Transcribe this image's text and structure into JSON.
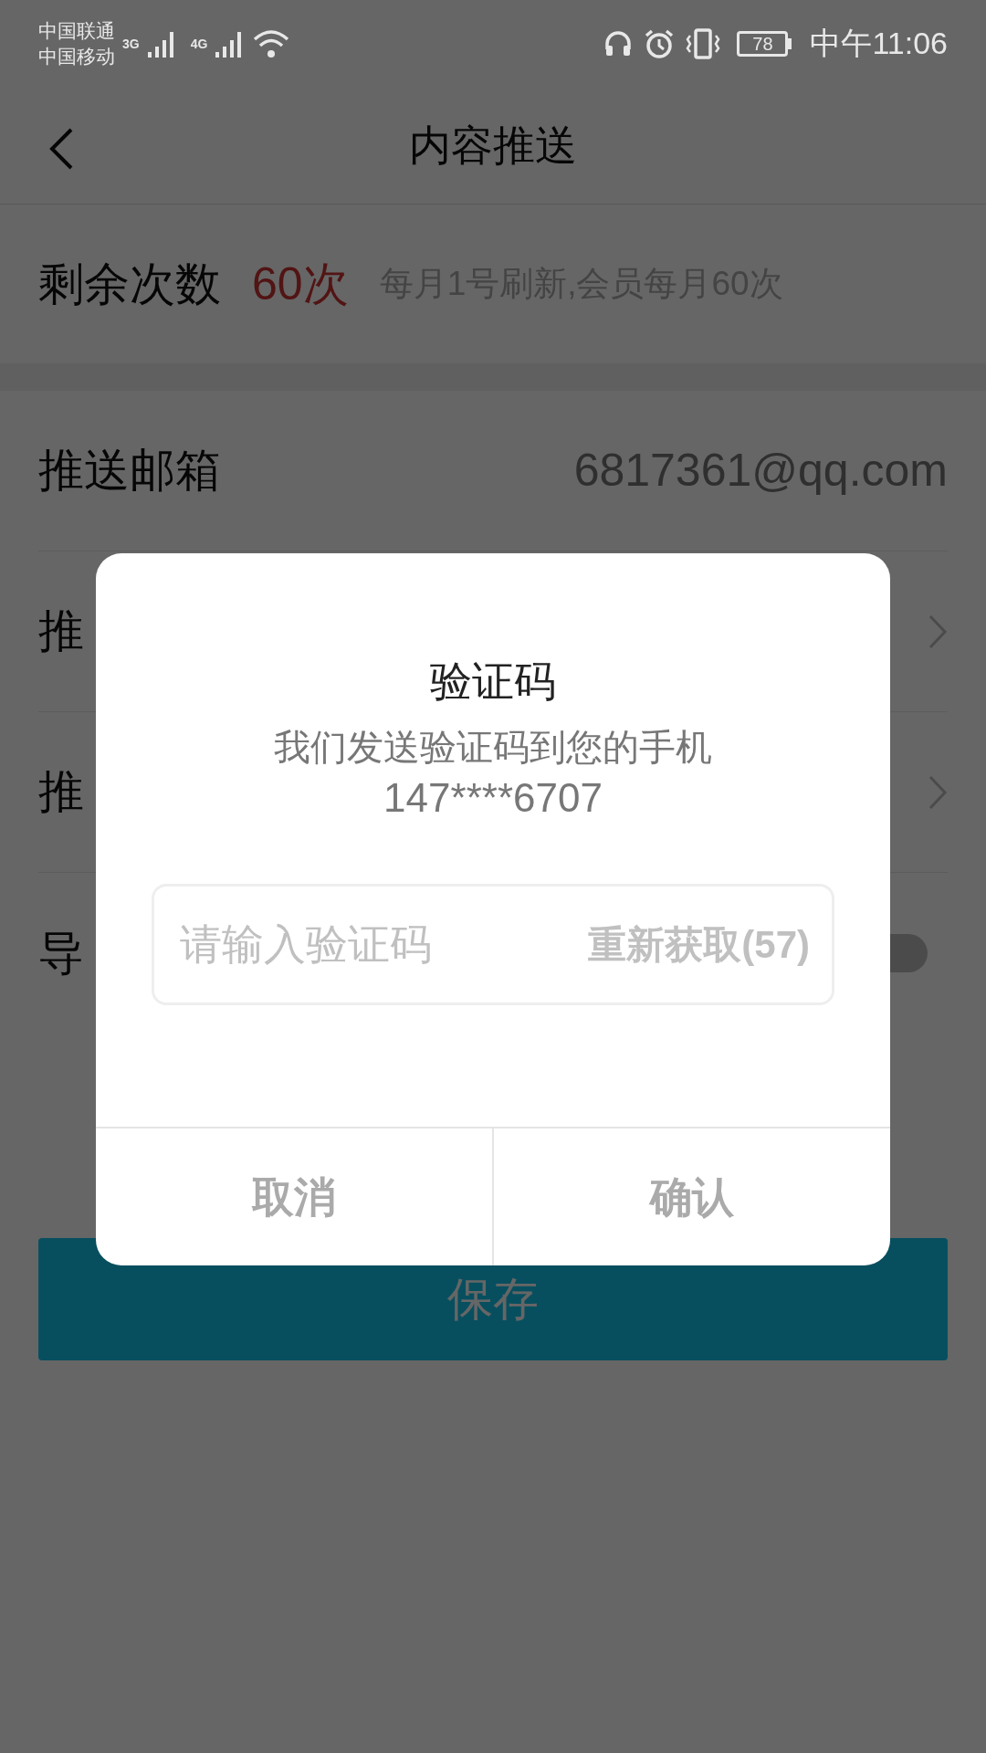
{
  "status_bar": {
    "carriers": [
      "中国联通",
      "中国移动"
    ],
    "network_1": "3G",
    "network_2": "4G",
    "battery": "78",
    "time": "中午11:06"
  },
  "header": {
    "title": "内容推送"
  },
  "quota": {
    "label": "剩余次数",
    "count": "60次",
    "note": "每月1号刷新,会员每月60次"
  },
  "rows": [
    {
      "kind": "value",
      "label": "推送邮箱",
      "value": "6817361@qq.com"
    },
    {
      "kind": "link",
      "label": "推"
    },
    {
      "kind": "link",
      "label": "推"
    },
    {
      "kind": "toggle",
      "label": "导",
      "on": false
    }
  ],
  "save_button": "保存",
  "dialog": {
    "title": "验证码",
    "message": "我们发送验证码到您的手机",
    "phone": "147****6707",
    "input": {
      "placeholder": "请输入验证码"
    },
    "resend": "重新获取(57)",
    "buttons": [
      "取消",
      "确认"
    ]
  }
}
